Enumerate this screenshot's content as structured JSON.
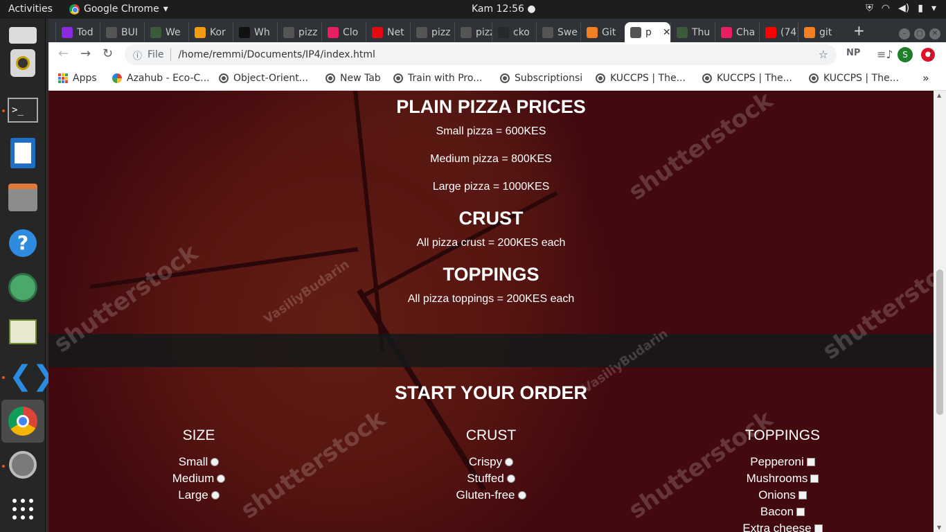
{
  "topbar": {
    "activities": "Activities",
    "app_name": "Google Chrome",
    "clock": "Kam 12:56"
  },
  "tabs": [
    {
      "label": "Tod",
      "color": "#8a2be2"
    },
    {
      "label": "BUI",
      "color": "#555555"
    },
    {
      "label": "We",
      "color": "#3a5a3a"
    },
    {
      "label": "Kor",
      "color": "#f39c12"
    },
    {
      "label": "Wh",
      "color": "#111111"
    },
    {
      "label": "pizz",
      "color": "#555555"
    },
    {
      "label": "Clo",
      "color": "#e91e63"
    },
    {
      "label": "Net",
      "color": "#e50914"
    },
    {
      "label": "pizz",
      "color": "#555555"
    },
    {
      "label": "pizz",
      "color": "#555555"
    },
    {
      "label": "cko",
      "color": "#24292e"
    },
    {
      "label": "Swe",
      "color": "#555555"
    },
    {
      "label": "Git",
      "color": "#f48024"
    },
    {
      "label": "p",
      "color": "#555555"
    },
    {
      "label": "Thu",
      "color": "#3a5a3a"
    },
    {
      "label": "Cha",
      "color": "#e91e63"
    },
    {
      "label": "(74)",
      "color": "#ff0000"
    },
    {
      "label": "git",
      "color": "#f48024"
    }
  ],
  "omnibox": {
    "scheme": "File",
    "url": "/home/remmi/Documents/IP4/index.html"
  },
  "extensions": {
    "np": "NP",
    "profile_initial": "S"
  },
  "bookmarks": [
    {
      "label": "Apps"
    },
    {
      "label": "Azahub - Eco-C..."
    },
    {
      "label": "Object-Orient..."
    },
    {
      "label": "New Tab"
    },
    {
      "label": "Train with Pro..."
    },
    {
      "label": "Subscriptionsi"
    },
    {
      "label": "KUCCPS | The..."
    },
    {
      "label": "KUCCPS | The..."
    },
    {
      "label": "KUCCPS | The..."
    }
  ],
  "page": {
    "prices_title": "PLAIN PIZZA PRICES",
    "small_price": "Small pizza = 600KES",
    "medium_price": "Medium pizza = 800KES",
    "large_price": "Large pizza = 1000KES",
    "crust_title": "CRUST",
    "crust_price": "All pizza crust = 200KES each",
    "toppings_title": "TOPPINGS",
    "toppings_price": "All pizza toppings = 200KES each",
    "order_title": "START YOUR ORDER",
    "size": {
      "heading": "SIZE",
      "options": [
        "Small",
        "Medium",
        "Large"
      ]
    },
    "crust": {
      "heading": "CRUST",
      "options": [
        "Crispy",
        "Stuffed",
        "Gluten-free"
      ]
    },
    "toppings": {
      "heading": "TOPPINGS",
      "options": [
        "Pepperoni",
        "Mushrooms",
        "Onions",
        "Bacon",
        "Extra cheese"
      ]
    },
    "watermarks": [
      "shutterstock",
      "VasiliyBudarin"
    ]
  }
}
